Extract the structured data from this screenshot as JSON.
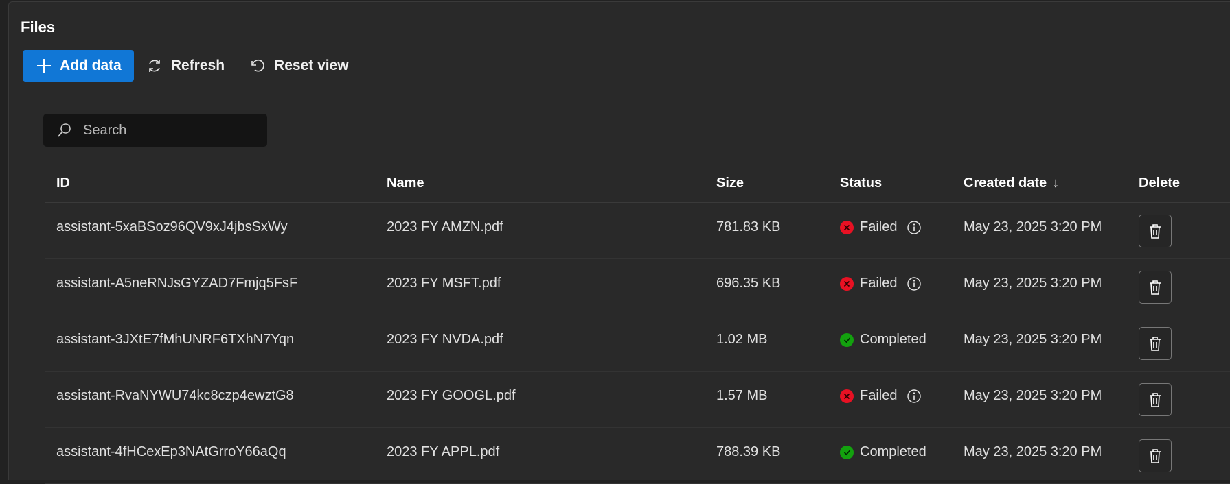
{
  "page": {
    "title": "Files"
  },
  "toolbar": {
    "add_label": "Add data",
    "refresh_label": "Refresh",
    "reset_label": "Reset view"
  },
  "search": {
    "placeholder": "Search",
    "value": ""
  },
  "table": {
    "columns": {
      "id": "ID",
      "name": "Name",
      "size": "Size",
      "status": "Status",
      "created": "Created date",
      "delete": "Delete"
    },
    "sort": {
      "column": "created",
      "direction": "descending",
      "icon": "arrow-down-icon"
    },
    "rows": [
      {
        "id": "assistant-5xaBSoz96QV9xJ4jbsSxWy",
        "name": "2023 FY AMZN.pdf",
        "size": "781.83 KB",
        "status": "Failed",
        "created": "May 23, 2025 3:20 PM"
      },
      {
        "id": "assistant-A5neRNJsGYZAD7Fmjq5FsF",
        "name": "2023 FY MSFT.pdf",
        "size": "696.35 KB",
        "status": "Failed",
        "created": "May 23, 2025 3:20 PM"
      },
      {
        "id": "assistant-3JXtE7fMhUNRF6TXhN7Yqn",
        "name": "2023 FY NVDA.pdf",
        "size": "1.02 MB",
        "status": "Completed",
        "created": "May 23, 2025 3:20 PM"
      },
      {
        "id": "assistant-RvaNYWU74kc8czp4ewztG8",
        "name": "2023 FY GOOGL.pdf",
        "size": "1.57 MB",
        "status": "Failed",
        "created": "May 23, 2025 3:20 PM"
      },
      {
        "id": "assistant-4fHCexEp3NAtGrroY66aQq",
        "name": "2023 FY APPL.pdf",
        "size": "788.39 KB",
        "status": "Completed",
        "created": "May 23, 2025 3:20 PM"
      }
    ]
  },
  "colors": {
    "accent": "#1177d6",
    "failed": "#e81123",
    "completed": "#13a10e",
    "background": "#292929"
  }
}
